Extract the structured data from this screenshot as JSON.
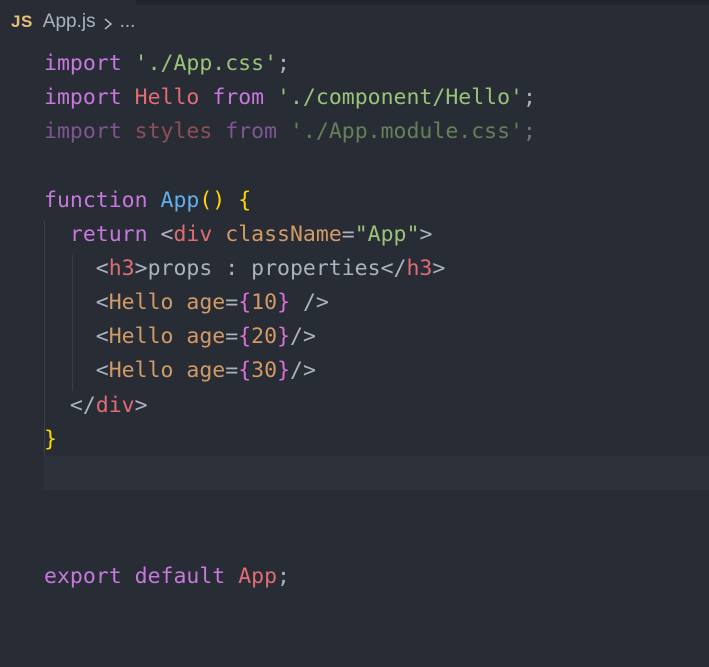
{
  "breadcrumb": {
    "lang_badge": "JS",
    "file": "App.js",
    "separator": "›",
    "more": "..."
  },
  "code": {
    "l1": {
      "kw": "import",
      "sp": " ",
      "str": "'./App.css'",
      "end": ";"
    },
    "l2": {
      "kw": "import",
      "sp1": " ",
      "name": "Hello",
      "sp2": " ",
      "from": "from",
      "sp3": " ",
      "str": "'./component/Hello'",
      "end": ";"
    },
    "l3": {
      "kw": "import",
      "sp1": " ",
      "name": "styles",
      "sp2": " ",
      "from": "from",
      "sp3": " ",
      "str": "'./App.module.css'",
      "end": ";"
    },
    "l5": {
      "kw": "function",
      "sp": " ",
      "name": "App",
      "paren": "()",
      "sp2": " ",
      "brace": "{"
    },
    "l6": {
      "indent": "  ",
      "kw": "return",
      "sp": " ",
      "lt": "<",
      "tag": "div",
      "sp2": " ",
      "attr": "className",
      "eq": "=",
      "str": "\"App\"",
      "gt": ">"
    },
    "l7": {
      "indent": "    ",
      "lt": "<",
      "tag": "h3",
      "gt": ">",
      "text": "props : properties",
      "close_lt": "</",
      "close_tag": "h3",
      "close_gt": ">"
    },
    "l8": {
      "indent": "    ",
      "lt": "<",
      "comp": "Hello",
      "sp": " ",
      "attr": "age",
      "eq": "=",
      "ob": "{",
      "num": "10",
      "cb": "}",
      "tail": " />"
    },
    "l9": {
      "indent": "    ",
      "lt": "<",
      "comp": "Hello",
      "sp": " ",
      "attr": "age",
      "eq": "=",
      "ob": "{",
      "num": "20",
      "cb": "}",
      "tail": "/>"
    },
    "l10": {
      "indent": "    ",
      "lt": "<",
      "comp": "Hello",
      "sp": " ",
      "attr": "age",
      "eq": "=",
      "ob": "{",
      "num": "30",
      "cb": "}",
      "tail": "/>"
    },
    "l11": {
      "indent": "  ",
      "lt": "</",
      "tag": "div",
      "gt": ">"
    },
    "l12": {
      "brace": "}"
    },
    "l16": {
      "kw": "export",
      "sp1": " ",
      "kw2": "default",
      "sp2": " ",
      "name": "App",
      "end": ";"
    }
  },
  "colors": {
    "background": "#282c34",
    "keyword": "#c678dd",
    "string": "#98c379",
    "function": "#61afef",
    "component": "#e06c75",
    "attribute": "#d19a66",
    "bracket_gold": "#ffd700",
    "bracket_purple": "#da70d6"
  },
  "icons": {
    "chevron": "chevron-right-icon",
    "lang": "js-file-icon"
  }
}
